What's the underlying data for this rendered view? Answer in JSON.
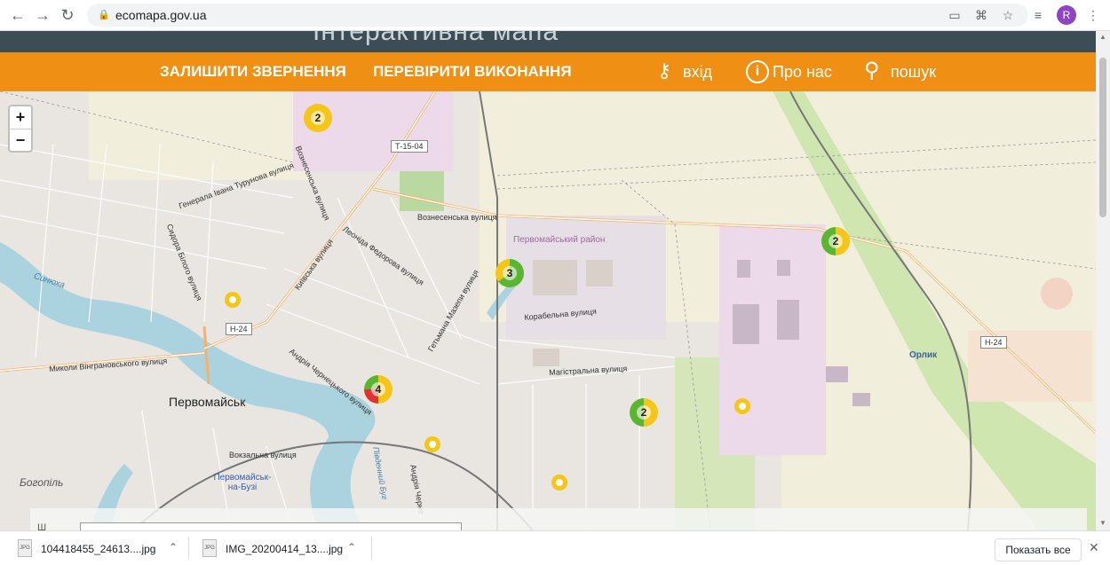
{
  "browser": {
    "url": "ecomapa.gov.ua",
    "profile_initial": "R"
  },
  "site": {
    "logo_text": "Інтерактивна мапа",
    "menu": {
      "submit": "ЗАЛИШИТИ ЗВЕРНЕННЯ",
      "check": "ПЕРЕВІРИТИ ВИКОНАННЯ",
      "login": "вхід",
      "about": "Про нас",
      "search": "пошук"
    },
    "accent_color": "#ef8f14"
  },
  "map": {
    "zoom_in": "+",
    "zoom_out": "−",
    "clusters": [
      "2",
      "2",
      "3",
      "4",
      "2"
    ],
    "labels": {
      "voznesenska1": "Вознесенська вулиця",
      "voznesenska2": "Вознесенська вулиця",
      "t1504": "Т-15-04",
      "h24a": "Н-24",
      "h24b": "Н-24",
      "turunova": "Генерала Івана Турунова вулиця",
      "leonida": "Леоніда Федорова вулиця",
      "kyivska": "Київська вулиця",
      "syinyukha": "Синюха",
      "sydora": "Сидора Білого вулиця",
      "pervomaiskyi": "Первомайський район",
      "korabelna": "Корабельна вулиця",
      "mazepy": "Гетьмана Мазепи вулиця",
      "mykoly": "Миколи Вінграновського вулиця",
      "chernetskyi": "Андрія Чернецького вулиця",
      "mahistralna": "Магістральна вулиця",
      "pervomaisk": "Первомайськ",
      "vokzalna": "Вокзальна вулиця",
      "pervomaisk_bug": "Первомайськ-на-Бузі",
      "bohopil": "Богопіль",
      "orlyk": "Орлик",
      "pivdennyi": "Південний Буг",
      "andriia": "Андрія Черне"
    },
    "search_label": "Ш"
  },
  "downloads": {
    "items": [
      {
        "name": "104418455_24613....jpg"
      },
      {
        "name": "IMG_20200414_13....jpg"
      }
    ],
    "show_all": "Показать все"
  }
}
